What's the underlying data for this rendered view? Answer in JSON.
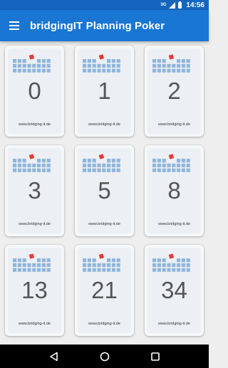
{
  "status_bar": {
    "network": "3G",
    "time": "14:56"
  },
  "app_bar": {
    "title": "bridgingIT Planning Poker",
    "menu_icon": "hamburger-menu-icon"
  },
  "cards": [
    {
      "value": "0",
      "footer": "www.bridging-it.de"
    },
    {
      "value": "1",
      "footer": "www.bridging-it.de"
    },
    {
      "value": "2",
      "footer": "www.bridging-it.de"
    },
    {
      "value": "3",
      "footer": "www.bridging-it.de"
    },
    {
      "value": "5",
      "footer": "www.bridging-it.de"
    },
    {
      "value": "8",
      "footer": "www.bridging-it.de"
    },
    {
      "value": "13",
      "footer": "www.bridging-it.de"
    },
    {
      "value": "21",
      "footer": "www.bridging-it.de"
    },
    {
      "value": "34",
      "footer": "www.bridging-it.de"
    }
  ],
  "nav_bar": {
    "back_icon": "back-triangle-icon",
    "home_icon": "home-circle-icon",
    "recents_icon": "recents-square-icon"
  },
  "colors": {
    "status_bar": "#1565c0",
    "app_bar": "#1976d2",
    "logo_blue": "#8fb6dc",
    "logo_red": "#e53935",
    "card_value": "#555555"
  }
}
